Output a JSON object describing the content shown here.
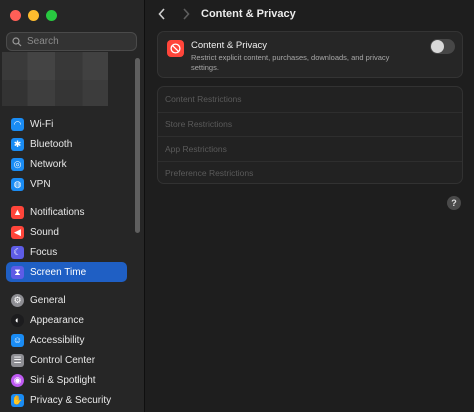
{
  "window": {
    "controls": [
      "close",
      "minimize",
      "zoom"
    ]
  },
  "sidebar": {
    "search": {
      "placeholder": "Search",
      "value": ""
    },
    "groups": [
      [
        {
          "label": "Wi-Fi",
          "icon": "wifi-icon",
          "color": "#1a8cf4",
          "selected": false
        },
        {
          "label": "Bluetooth",
          "icon": "bluetooth-icon",
          "color": "#1a8cf4",
          "selected": false
        },
        {
          "label": "Network",
          "icon": "globe-icon",
          "color": "#1a8cf4",
          "selected": false
        },
        {
          "label": "VPN",
          "icon": "vpn-icon",
          "color": "#1a8cf4",
          "selected": false
        }
      ],
      [
        {
          "label": "Notifications",
          "icon": "bell-icon",
          "color": "#ff453a",
          "selected": false
        },
        {
          "label": "Sound",
          "icon": "speaker-icon",
          "color": "#ff453a",
          "selected": false
        },
        {
          "label": "Focus",
          "icon": "moon-icon",
          "color": "#5e5ce6",
          "selected": false
        },
        {
          "label": "Screen Time",
          "icon": "hourglass-icon",
          "color": "#5e5ce6",
          "selected": true
        }
      ],
      [
        {
          "label": "General",
          "icon": "gear-icon",
          "color": "#8e8e93",
          "selected": false
        },
        {
          "label": "Appearance",
          "icon": "appearance-icon",
          "color": "#1c1c1e",
          "selected": false
        },
        {
          "label": "Accessibility",
          "icon": "accessibility-icon",
          "color": "#1a8cf4",
          "selected": false
        },
        {
          "label": "Control Center",
          "icon": "control-center-icon",
          "color": "#8e8e93",
          "selected": false
        },
        {
          "label": "Siri & Spotlight",
          "icon": "siri-icon",
          "color": "#bf5af2",
          "selected": false
        },
        {
          "label": "Privacy & Security",
          "icon": "hand-icon",
          "color": "#1a8cf4",
          "selected": false
        }
      ]
    ]
  },
  "header": {
    "title": "Content & Privacy"
  },
  "content_privacy": {
    "title": "Content & Privacy",
    "description": "Restrict explicit content, purchases, downloads, and privacy settings.",
    "enabled": false,
    "icon": "no-entry-icon",
    "icon_color": "#ff453a"
  },
  "restrictions": [
    {
      "label": "Content Restrictions",
      "enabled": false
    },
    {
      "label": "Store Restrictions",
      "enabled": false
    },
    {
      "label": "App Restrictions",
      "enabled": false
    },
    {
      "label": "Preference Restrictions",
      "enabled": false
    }
  ],
  "help": {
    "label": "?"
  }
}
